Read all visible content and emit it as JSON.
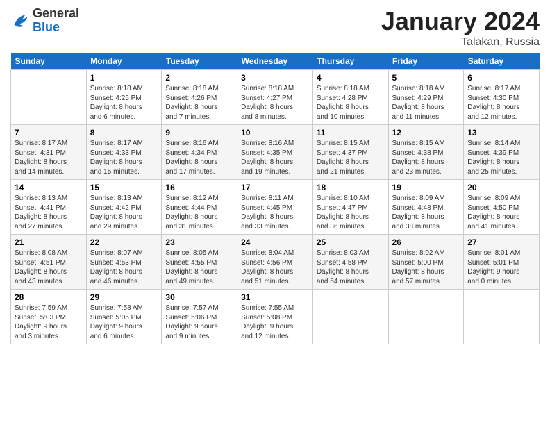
{
  "header": {
    "logo_general": "General",
    "logo_blue": "Blue",
    "month_title": "January 2024",
    "location": "Talakan, Russia"
  },
  "weekdays": [
    "Sunday",
    "Monday",
    "Tuesday",
    "Wednesday",
    "Thursday",
    "Friday",
    "Saturday"
  ],
  "weeks": [
    [
      {
        "day": "",
        "info": ""
      },
      {
        "day": "1",
        "info": "Sunrise: 8:18 AM\nSunset: 4:25 PM\nDaylight: 8 hours\nand 6 minutes."
      },
      {
        "day": "2",
        "info": "Sunrise: 8:18 AM\nSunset: 4:26 PM\nDaylight: 8 hours\nand 7 minutes."
      },
      {
        "day": "3",
        "info": "Sunrise: 8:18 AM\nSunset: 4:27 PM\nDaylight: 8 hours\nand 8 minutes."
      },
      {
        "day": "4",
        "info": "Sunrise: 8:18 AM\nSunset: 4:28 PM\nDaylight: 8 hours\nand 10 minutes."
      },
      {
        "day": "5",
        "info": "Sunrise: 8:18 AM\nSunset: 4:29 PM\nDaylight: 8 hours\nand 11 minutes."
      },
      {
        "day": "6",
        "info": "Sunrise: 8:17 AM\nSunset: 4:30 PM\nDaylight: 8 hours\nand 12 minutes."
      }
    ],
    [
      {
        "day": "7",
        "info": "Sunrise: 8:17 AM\nSunset: 4:31 PM\nDaylight: 8 hours\nand 14 minutes."
      },
      {
        "day": "8",
        "info": "Sunrise: 8:17 AM\nSunset: 4:33 PM\nDaylight: 8 hours\nand 15 minutes."
      },
      {
        "day": "9",
        "info": "Sunrise: 8:16 AM\nSunset: 4:34 PM\nDaylight: 8 hours\nand 17 minutes."
      },
      {
        "day": "10",
        "info": "Sunrise: 8:16 AM\nSunset: 4:35 PM\nDaylight: 8 hours\nand 19 minutes."
      },
      {
        "day": "11",
        "info": "Sunrise: 8:15 AM\nSunset: 4:37 PM\nDaylight: 8 hours\nand 21 minutes."
      },
      {
        "day": "12",
        "info": "Sunrise: 8:15 AM\nSunset: 4:38 PM\nDaylight: 8 hours\nand 23 minutes."
      },
      {
        "day": "13",
        "info": "Sunrise: 8:14 AM\nSunset: 4:39 PM\nDaylight: 8 hours\nand 25 minutes."
      }
    ],
    [
      {
        "day": "14",
        "info": "Sunrise: 8:13 AM\nSunset: 4:41 PM\nDaylight: 8 hours\nand 27 minutes."
      },
      {
        "day": "15",
        "info": "Sunrise: 8:13 AM\nSunset: 4:42 PM\nDaylight: 8 hours\nand 29 minutes."
      },
      {
        "day": "16",
        "info": "Sunrise: 8:12 AM\nSunset: 4:44 PM\nDaylight: 8 hours\nand 31 minutes."
      },
      {
        "day": "17",
        "info": "Sunrise: 8:11 AM\nSunset: 4:45 PM\nDaylight: 8 hours\nand 33 minutes."
      },
      {
        "day": "18",
        "info": "Sunrise: 8:10 AM\nSunset: 4:47 PM\nDaylight: 8 hours\nand 36 minutes."
      },
      {
        "day": "19",
        "info": "Sunrise: 8:09 AM\nSunset: 4:48 PM\nDaylight: 8 hours\nand 38 minutes."
      },
      {
        "day": "20",
        "info": "Sunrise: 8:09 AM\nSunset: 4:50 PM\nDaylight: 8 hours\nand 41 minutes."
      }
    ],
    [
      {
        "day": "21",
        "info": "Sunrise: 8:08 AM\nSunset: 4:51 PM\nDaylight: 8 hours\nand 43 minutes."
      },
      {
        "day": "22",
        "info": "Sunrise: 8:07 AM\nSunset: 4:53 PM\nDaylight: 8 hours\nand 46 minutes."
      },
      {
        "day": "23",
        "info": "Sunrise: 8:05 AM\nSunset: 4:55 PM\nDaylight: 8 hours\nand 49 minutes."
      },
      {
        "day": "24",
        "info": "Sunrise: 8:04 AM\nSunset: 4:56 PM\nDaylight: 8 hours\nand 51 minutes."
      },
      {
        "day": "25",
        "info": "Sunrise: 8:03 AM\nSunset: 4:58 PM\nDaylight: 8 hours\nand 54 minutes."
      },
      {
        "day": "26",
        "info": "Sunrise: 8:02 AM\nSunset: 5:00 PM\nDaylight: 8 hours\nand 57 minutes."
      },
      {
        "day": "27",
        "info": "Sunrise: 8:01 AM\nSunset: 5:01 PM\nDaylight: 9 hours\nand 0 minutes."
      }
    ],
    [
      {
        "day": "28",
        "info": "Sunrise: 7:59 AM\nSunset: 5:03 PM\nDaylight: 9 hours\nand 3 minutes."
      },
      {
        "day": "29",
        "info": "Sunrise: 7:58 AM\nSunset: 5:05 PM\nDaylight: 9 hours\nand 6 minutes."
      },
      {
        "day": "30",
        "info": "Sunrise: 7:57 AM\nSunset: 5:06 PM\nDaylight: 9 hours\nand 9 minutes."
      },
      {
        "day": "31",
        "info": "Sunrise: 7:55 AM\nSunset: 5:08 PM\nDaylight: 9 hours\nand 12 minutes."
      },
      {
        "day": "",
        "info": ""
      },
      {
        "day": "",
        "info": ""
      },
      {
        "day": "",
        "info": ""
      }
    ]
  ]
}
